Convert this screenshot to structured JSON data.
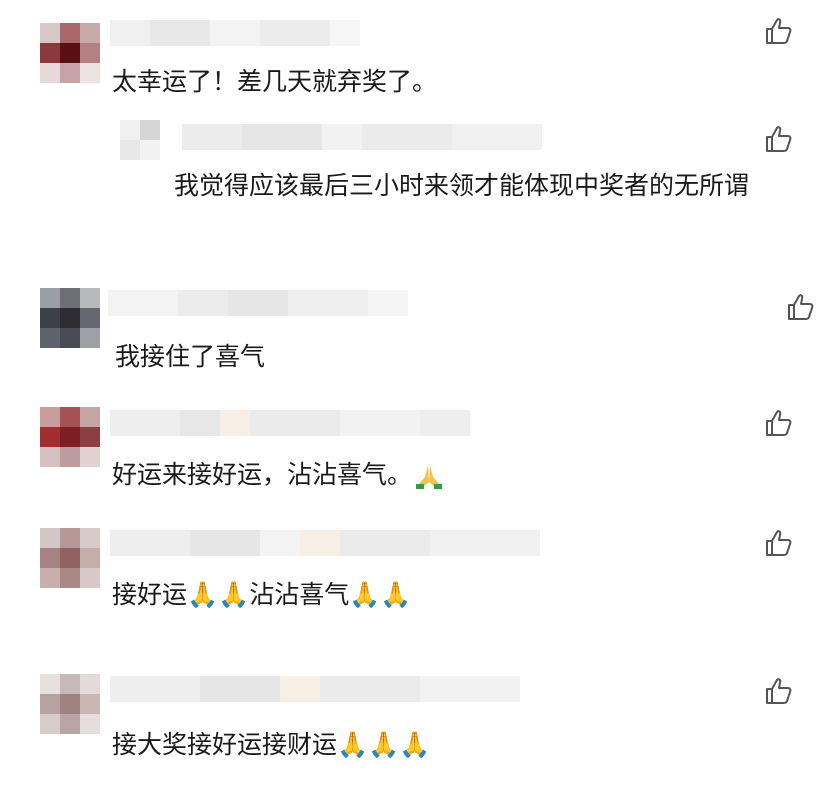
{
  "comments": [
    {
      "text": "太幸运了！差几天就弃奖了。",
      "emoji_count": 0,
      "reply": {
        "text": "我觉得应该最后三小时来领才能体现中奖者的无所谓"
      }
    },
    {
      "text": "我接住了喜气",
      "emoji_count": 0
    },
    {
      "text": "好运来接好运，沾沾喜气。",
      "emoji_count": 1
    },
    {
      "text": "接好运🙏🙏沾沾喜气🙏🙏",
      "emoji_count": 0
    },
    {
      "text": "接大奖接好运接财运🙏🙏🙏",
      "emoji_count": 0
    }
  ],
  "icons": {
    "like": "thumbs-up-icon",
    "pray": "folded-hands-icon"
  },
  "colors": {
    "avatar_blur_1": [
      "#d9c8c8",
      "#a8676a",
      "#c9aaab",
      "#8a3a3d",
      "#5a0f14",
      "#b48183",
      "#e7d9d9",
      "#c7a3a5",
      "#ece3e3"
    ],
    "avatar_blur_2": [
      "#9a9fa5",
      "#6d6f74",
      "#b7b9bb",
      "#3e4049",
      "#2f2b33",
      "#65686f",
      "#5e626c",
      "#4a4c55",
      "#9fa1a6"
    ],
    "avatar_blur_3": [
      "#c79d9e",
      "#a35353",
      "#c5a6a7",
      "#a12c31",
      "#7d1e24",
      "#8c3e40",
      "#d6c0c1",
      "#be9c9d",
      "#e0d2d2"
    ],
    "avatar_blur_4": [
      "#d3c6c6",
      "#b79897",
      "#d6caca",
      "#a58382",
      "#8e6261",
      "#c5adab",
      "#c8aeac",
      "#a98885",
      "#d7c9c8"
    ],
    "avatar_blur_5": [
      "#e8dfdf",
      "#c7b9b9",
      "#e3dbdb",
      "#b7a2a1",
      "#9c8380",
      "#cab7b5",
      "#d8cccb",
      "#b8a6a4",
      "#e6dede"
    ]
  }
}
